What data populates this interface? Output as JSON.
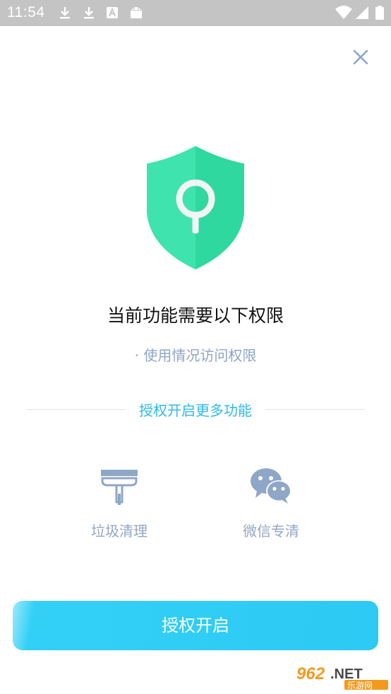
{
  "status_bar": {
    "time": "11:54",
    "icons": [
      "download-icon",
      "download-icon",
      "a-icon",
      "android-icon",
      "wifi-icon",
      "signal-icon",
      "battery-icon"
    ]
  },
  "dialog": {
    "close_icon": "close-icon",
    "shield_icon": "shield-key-icon",
    "title": "当前功能需要以下权限",
    "permission_item": "· 使用情况访问权限",
    "section_heading": "授权开启更多功能",
    "features": [
      {
        "icon": "brush-icon",
        "label": "垃圾清理"
      },
      {
        "icon": "wechat-icon",
        "label": "微信专清"
      }
    ],
    "button_label": "授权开启"
  },
  "watermark": {
    "brand": "962.NET",
    "sub": "乐游网"
  },
  "colors": {
    "status_bar_bg": "#c4c4c4",
    "shield_light": "#3fe3ad",
    "shield_dark": "#2fd89f",
    "accent_blue": "#2fb8ea",
    "button_bg": "#2ccaf4",
    "muted_text": "#8fa6c5"
  }
}
